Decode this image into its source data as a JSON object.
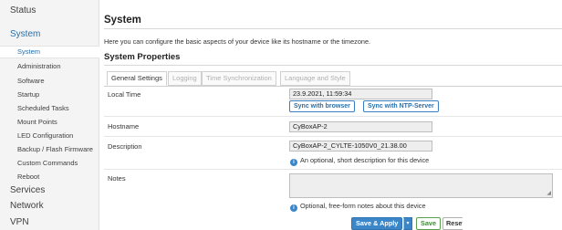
{
  "sidebar": {
    "top": {
      "status": "Status",
      "system": "System",
      "services": "Services",
      "network": "Network",
      "vpn": "VPN"
    },
    "system_sub": [
      "System",
      "Administration",
      "Software",
      "Startup",
      "Scheduled Tasks",
      "Mount Points",
      "LED Configuration",
      "Backup / Flash Firmware",
      "Custom Commands",
      "Reboot"
    ]
  },
  "main": {
    "title": "System",
    "description": "Here you can configure the basic aspects of your device like its hostname or the timezone.",
    "section_title": "System Properties",
    "tabs": [
      {
        "label": "General Settings",
        "active": true
      },
      {
        "label": "Logging",
        "active": false
      },
      {
        "label": "Time Synchronization",
        "active": false
      },
      {
        "label": "Language and Style",
        "active": false
      }
    ],
    "local_time": {
      "label": "Local Time",
      "value": "23.9.2021, 11:59:34",
      "sync_browser": "Sync with browser",
      "sync_ntp": "Sync with NTP-Server"
    },
    "hostname": {
      "label": "Hostname",
      "value": "CyBoxAP-2"
    },
    "description_field": {
      "label": "Description",
      "value": "CyBoxAP-2_CYLTE-1050V0_21.38.00",
      "help": "An optional, short description for this device"
    },
    "notes": {
      "label": "Notes",
      "value": "",
      "help": "Optional, free-form notes about this device"
    }
  },
  "footer": {
    "save_apply": "Save & Apply",
    "dropdown_glyph": "▾",
    "save": "Save",
    "reset": "Reset"
  },
  "colors": {
    "accent": "#3a86c8",
    "link": "#2a6ea6",
    "save_green": "#3f8c36"
  },
  "icons": {
    "help": "info-circle-icon",
    "dropdown": "chevron-down-icon",
    "resize": "resize-grip-icon"
  }
}
